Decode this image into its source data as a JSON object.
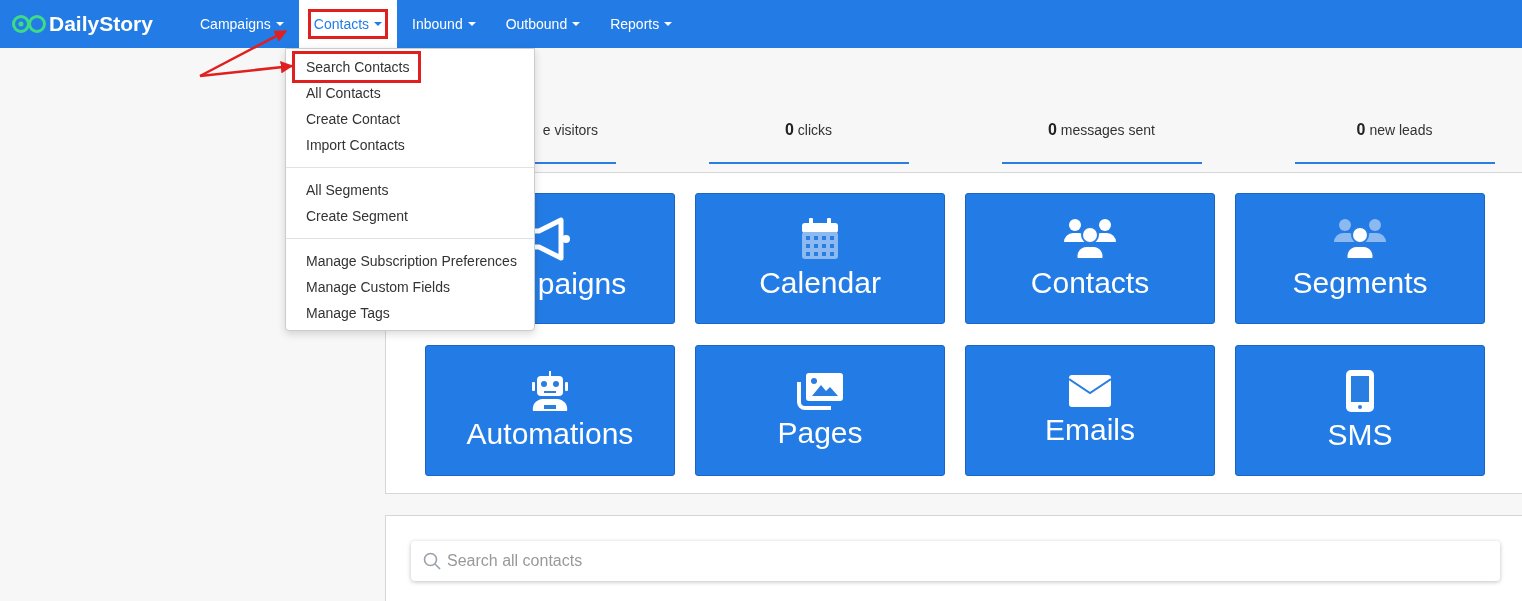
{
  "brand": {
    "name": "DailyStory"
  },
  "nav": [
    {
      "label": "Campaigns",
      "selected": false,
      "annotated": false
    },
    {
      "label": "Contacts",
      "selected": true,
      "annotated": true
    },
    {
      "label": "Inbound",
      "selected": false,
      "annotated": false
    },
    {
      "label": "Outbound",
      "selected": false,
      "annotated": false
    },
    {
      "label": "Reports",
      "selected": false,
      "annotated": false
    }
  ],
  "menu": {
    "groups": [
      [
        {
          "label": "Search Contacts",
          "annotated": true
        },
        {
          "label": "All Contacts",
          "annotated": false
        },
        {
          "label": "Create Contact",
          "annotated": false
        },
        {
          "label": "Import Contacts",
          "annotated": false
        }
      ],
      [
        {
          "label": "All Segments",
          "annotated": false
        },
        {
          "label": "Create Segment",
          "annotated": false
        }
      ],
      [
        {
          "label": "Manage Subscription Preferences",
          "annotated": false
        },
        {
          "label": "Manage Custom Fields",
          "annotated": false
        },
        {
          "label": "Manage Tags",
          "annotated": false
        }
      ]
    ]
  },
  "stats": [
    {
      "label": "e visitors"
    },
    {
      "value": "0",
      "label": "clicks"
    },
    {
      "value": "0",
      "label": "messages sent"
    },
    {
      "value": "0",
      "label": "new leads"
    }
  ],
  "tiles": [
    {
      "label": "paigns"
    },
    {
      "label": "Calendar"
    },
    {
      "label": "Contacts"
    },
    {
      "label": "Segments"
    },
    {
      "label": "Automations"
    },
    {
      "label": "Pages"
    },
    {
      "label": "Emails"
    },
    {
      "label": "SMS"
    }
  ],
  "search": {
    "placeholder": "Search all contacts"
  }
}
